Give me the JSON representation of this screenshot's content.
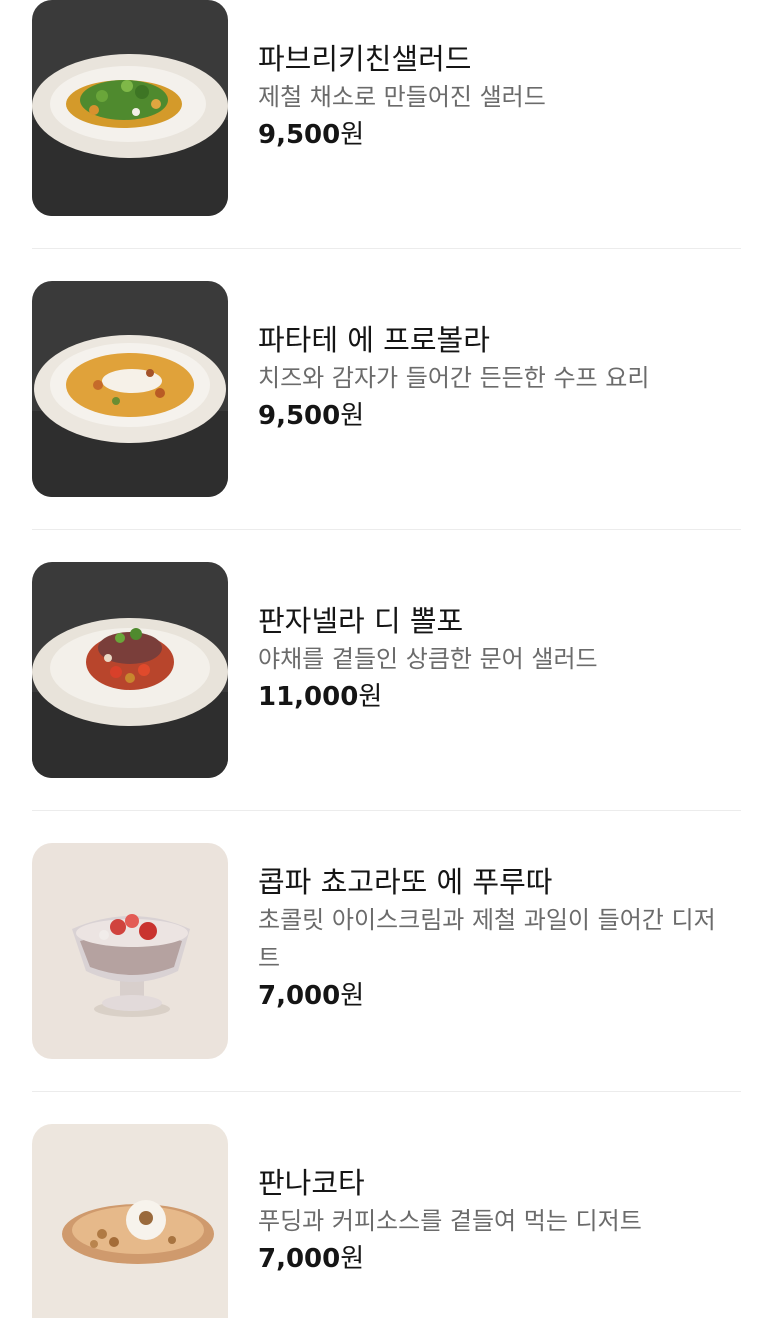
{
  "menu": {
    "items": [
      {
        "name": "파브리키친샐러드",
        "description": "제철 채소로 만들어진 샐러드",
        "price_amount": "9,500",
        "price_unit": "원",
        "image_icon": "salad-plate-photo"
      },
      {
        "name": "파타테 에 프로볼라",
        "description": "치즈와 감자가 들어간 든든한 수프 요리",
        "price_amount": "9,500",
        "price_unit": "원",
        "image_icon": "soup-bowl-photo"
      },
      {
        "name": "판자넬라 디 뽈포",
        "description": "야채를 곁들인 상큼한 문어 샐러드",
        "price_amount": "11,000",
        "price_unit": "원",
        "image_icon": "octopus-salad-photo"
      },
      {
        "name": "콥파 쵸고라또 에 푸루따",
        "description": "초콜릿 아이스크림과 제철 과일이 들어간 디저트",
        "price_amount": "7,000",
        "price_unit": "원",
        "image_icon": "dessert-glass-photo"
      },
      {
        "name": "판나코타",
        "description": "푸딩과 커피소스를 곁들여 먹는 디저트",
        "price_amount": "7,000",
        "price_unit": "원",
        "image_icon": "panna-cotta-photo"
      }
    ]
  },
  "colors": {
    "text_primary": "#151515",
    "text_secondary": "#6b6b6b",
    "divider": "#ececec",
    "dark_photo_bg": "#3a3a3a",
    "light_photo_bg": "#ebe3dc"
  }
}
